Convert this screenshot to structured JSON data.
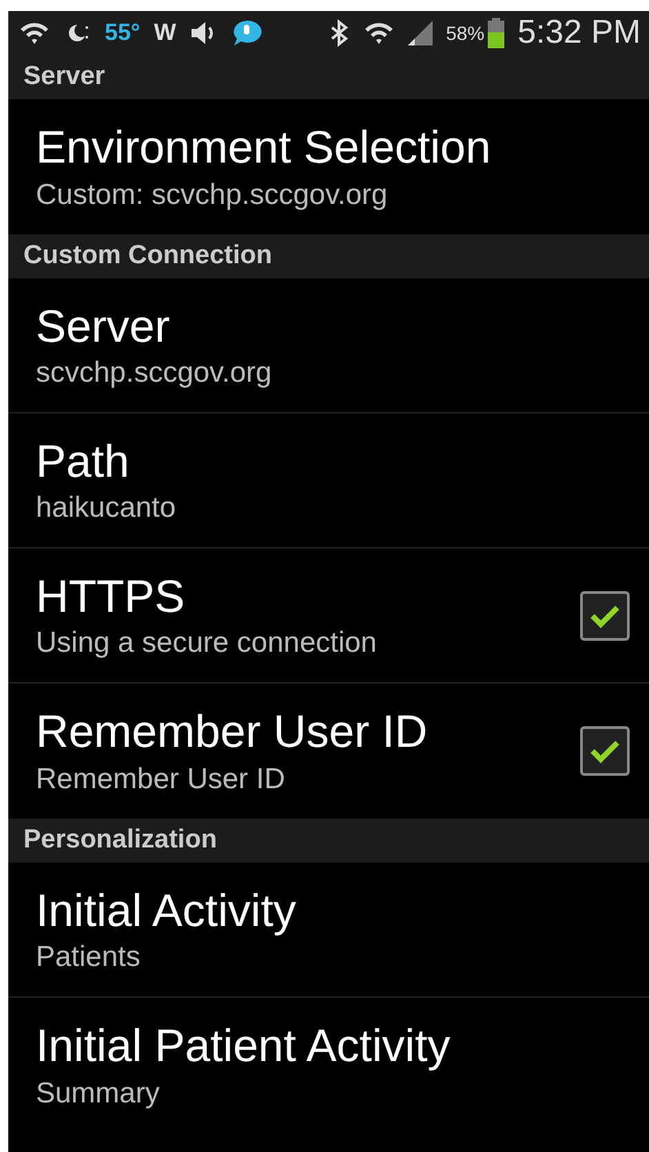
{
  "status_bar": {
    "temperature": "55°",
    "weather_letter": "W",
    "battery": {
      "percent": "58%",
      "level": 0.58
    },
    "time": "5:32 PM"
  },
  "sections": [
    {
      "title": "Server",
      "items": [
        {
          "kind": "text",
          "title": "Environment Selection",
          "summary": "Custom: scvchp.sccgov.org"
        }
      ]
    },
    {
      "title": "Custom Connection",
      "items": [
        {
          "kind": "text",
          "title": "Server",
          "summary": "scvchp.sccgov.org"
        },
        {
          "kind": "text",
          "title": "Path",
          "summary": "haikucanto"
        },
        {
          "kind": "checkbox",
          "title": "HTTPS",
          "summary": "Using a secure connection",
          "checked": true
        },
        {
          "kind": "checkbox",
          "title": "Remember User ID",
          "summary": "Remember User ID",
          "checked": true
        }
      ]
    },
    {
      "title": "Personalization",
      "items": [
        {
          "kind": "text",
          "title": "Initial Activity",
          "summary": "Patients"
        },
        {
          "kind": "text",
          "title": "Initial Patient Activity",
          "summary": "Summary"
        }
      ]
    }
  ]
}
